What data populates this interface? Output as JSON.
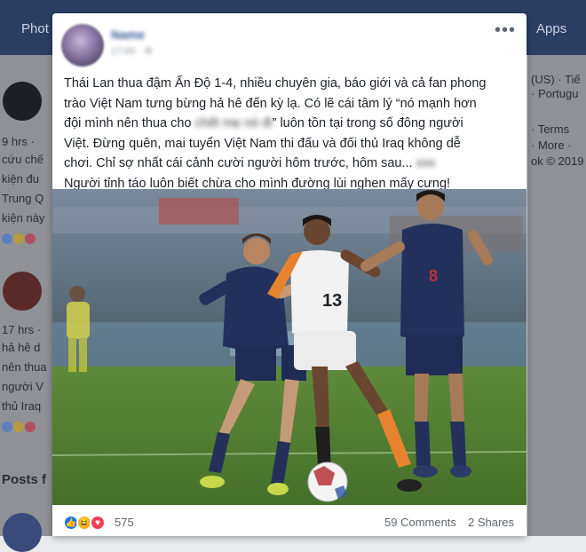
{
  "background": {
    "nav_left": "Phot",
    "nav_right": "Apps",
    "right_column": [
      "(US) · Tiế",
      "· Portugu",
      "· Terms",
      "· More ·",
      "ok © 2019"
    ],
    "left_column": [
      "9 hrs ·",
      "cứu chế",
      "kiện đu",
      "Trung Q",
      "kiện này",
      "17 hrs ·",
      "hả hê d",
      "nên thua",
      "người V",
      "thủ Iraq",
      "Posts f"
    ]
  },
  "post": {
    "author": "Name",
    "time": "17:00 · ⚙",
    "text": {
      "line1": "Thái Lan thua đậm Ấn Độ 1-4, nhiều chuyên gia, báo giới và cả fan phong",
      "line2": "trào Việt Nam tưng bừng hả hê đến kỳ lạ. Có lẽ cái tâm lý “nó mạnh hơn",
      "line3_a": "đội mình nên thua cho ",
      "line3_blur": "chết mẹ nó đi",
      "line3_b": "” luôn tồn tại trong số đông người",
      "line4": "Việt. Đừng quên, mai tuyển Việt Nam thi đấu và đối thủ Iraq không dễ",
      "line5_a": "chơi. Chỉ sợ nhất cái cảnh cười người hôm trước, hôm sau... ",
      "line5_blur": "xxx",
      "line6": "Người tỉnh táo luôn biết chừa cho mình đường lùi nghen mấy cưng!"
    },
    "photo": {
      "player_number": "13",
      "description_icon": "football-photo"
    },
    "reactions": {
      "icons": [
        "like-icon",
        "haha-icon",
        "love-icon"
      ],
      "count": "575"
    },
    "comments": "59 Comments",
    "shares": "2 Shares",
    "colors": {
      "like": "#1877f2",
      "haha": "#f7b125",
      "love": "#f33e58",
      "link": "#385898"
    }
  }
}
